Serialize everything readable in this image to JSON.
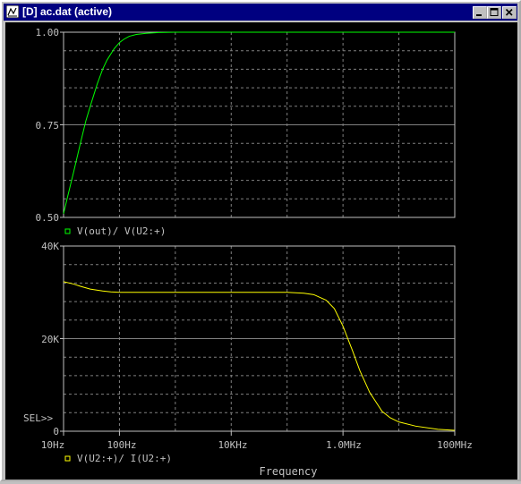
{
  "window": {
    "title": "[D] ac.dat (active)",
    "buttons": {
      "minimize": "minimize-icon",
      "maximize": "maximize-icon",
      "close": "close-icon"
    }
  },
  "colors": {
    "background": "#000000",
    "grid": "#808080",
    "axis_text": "#c0c0c0",
    "trace_top": "#00ff00",
    "trace_bottom": "#ffff00"
  },
  "chart_data": [
    {
      "type": "line",
      "xscale": "log",
      "xlim": [
        10,
        100000000
      ],
      "ylim": [
        0.5,
        1.0
      ],
      "yticks": [
        0.5,
        0.75,
        1.0
      ],
      "ytick_labels": [
        "0.50",
        "0.75",
        "1.00"
      ],
      "grid": true,
      "series": [
        {
          "name": "V(out)/ V(U2:+)",
          "x": [
            10,
            12,
            15,
            20,
            25,
            30,
            40,
            50,
            60,
            80,
            100,
            120,
            150,
            200,
            300,
            500,
            1000,
            10000,
            100000,
            1000000,
            10000000,
            100000000
          ],
          "y": [
            0.51,
            0.56,
            0.62,
            0.7,
            0.76,
            0.8,
            0.86,
            0.9,
            0.925,
            0.955,
            0.972,
            0.981,
            0.989,
            0.994,
            0.997,
            0.999,
            1.0,
            1.0,
            1.0,
            1.0,
            1.0,
            1.0
          ]
        }
      ]
    },
    {
      "type": "line",
      "xscale": "log",
      "xlim": [
        10,
        100000000
      ],
      "ylim": [
        0,
        40000
      ],
      "yticks": [
        0,
        20000,
        40000
      ],
      "ytick_labels": [
        "0",
        "20K",
        "40K"
      ],
      "xticks": [
        10,
        100,
        10000,
        1000000,
        100000000
      ],
      "xtick_labels": [
        "10Hz",
        "100Hz",
        "10KHz",
        "1.0MHz",
        "100MHz"
      ],
      "xlabel": "Frequency",
      "grid": true,
      "series": [
        {
          "name": "V(U2:+)/ I(U2:+)",
          "x": [
            10,
            15,
            20,
            30,
            50,
            70,
            100,
            200,
            1000,
            10000,
            100000,
            200000,
            300000,
            500000,
            700000,
            1000000,
            1500000,
            2000000,
            3000000,
            5000000,
            7000000,
            10000000,
            20000000,
            50000000,
            100000000
          ],
          "y": [
            32300,
            31800,
            31300,
            30700,
            30300,
            30100,
            30000,
            30000,
            30000,
            30000,
            30000,
            29800,
            29500,
            28300,
            26500,
            22700,
            17200,
            13100,
            8400,
            4300,
            2900,
            2000,
            1100,
            400,
            200
          ]
        }
      ]
    }
  ],
  "sel_marker": "SEL>>"
}
